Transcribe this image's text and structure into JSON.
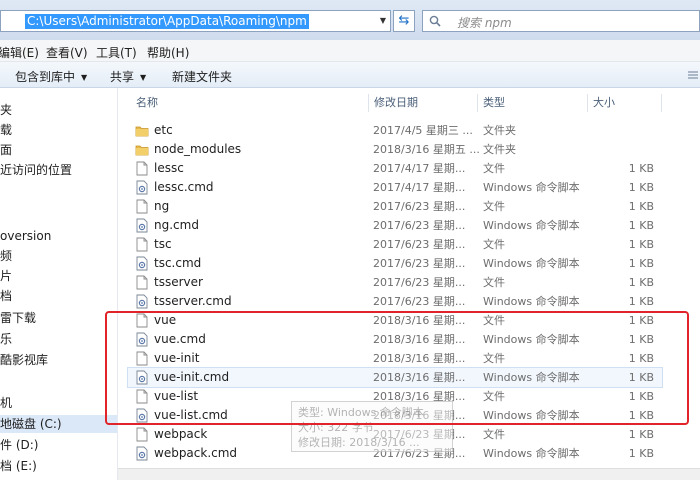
{
  "address": {
    "path": "C:\\Users\\Administrator\\AppData\\Roaming\\npm",
    "search_placeholder": "搜索 npm"
  },
  "menu": [
    "编辑(E)",
    "查看(V)",
    "工具(T)",
    "帮助(H)"
  ],
  "toolbar": {
    "include_library": "包含到库中",
    "share": "共享",
    "new_folder": "新建文件夹"
  },
  "nav": [
    {
      "label": "夹"
    },
    {
      "label": "载"
    },
    {
      "label": "面"
    },
    {
      "label": "近访问的位置"
    },
    {
      "label": ""
    },
    {
      "label": ""
    },
    {
      "label": "oversion"
    },
    {
      "label": "频"
    },
    {
      "label": "片"
    },
    {
      "label": "档"
    },
    {
      "label": "雷下载"
    },
    {
      "label": "乐"
    },
    {
      "label": "酷影视库"
    },
    {
      "label": ""
    },
    {
      "label": ""
    },
    {
      "label": "机"
    },
    {
      "label": "地磁盘 (C:)"
    },
    {
      "label": "件 (D:)"
    },
    {
      "label": "档 (E:)"
    }
  ],
  "columns": {
    "name": "名称",
    "date": "修改日期",
    "type": "类型",
    "size": "大小"
  },
  "files": [
    {
      "name": "etc",
      "date": "2017/4/5 星期三 ...",
      "type": "文件夹",
      "size": "",
      "icon": "folder-icon"
    },
    {
      "name": "node_modules",
      "date": "2018/3/16 星期五 ...",
      "type": "文件夹",
      "size": "",
      "icon": "folder-icon"
    },
    {
      "name": "lessc",
      "date": "2017/4/17 星期...",
      "type": "文件",
      "size": "1 KB",
      "icon": "file-icon"
    },
    {
      "name": "lessc.cmd",
      "date": "2017/4/17 星期...",
      "type": "Windows 命令脚本",
      "size": "1 KB",
      "icon": "cmd-icon"
    },
    {
      "name": "ng",
      "date": "2017/6/23 星期...",
      "type": "文件",
      "size": "1 KB",
      "icon": "file-icon"
    },
    {
      "name": "ng.cmd",
      "date": "2017/6/23 星期...",
      "type": "Windows 命令脚本",
      "size": "1 KB",
      "icon": "cmd-icon"
    },
    {
      "name": "tsc",
      "date": "2017/6/23 星期...",
      "type": "文件",
      "size": "1 KB",
      "icon": "file-icon"
    },
    {
      "name": "tsc.cmd",
      "date": "2017/6/23 星期...",
      "type": "Windows 命令脚本",
      "size": "1 KB",
      "icon": "cmd-icon"
    },
    {
      "name": "tsserver",
      "date": "2017/6/23 星期...",
      "type": "文件",
      "size": "1 KB",
      "icon": "file-icon"
    },
    {
      "name": "tsserver.cmd",
      "date": "2017/6/23 星期...",
      "type": "Windows 命令脚本",
      "size": "1 KB",
      "icon": "cmd-icon"
    },
    {
      "name": "vue",
      "date": "2018/3/16 星期...",
      "type": "文件",
      "size": "1 KB",
      "icon": "file-icon"
    },
    {
      "name": "vue.cmd",
      "date": "2018/3/16 星期...",
      "type": "Windows 命令脚本",
      "size": "1 KB",
      "icon": "cmd-icon"
    },
    {
      "name": "vue-init",
      "date": "2018/3/16 星期...",
      "type": "文件",
      "size": "1 KB",
      "icon": "file-icon"
    },
    {
      "name": "vue-init.cmd",
      "date": "2018/3/16 星期...",
      "type": "Windows 命令脚本",
      "size": "1 KB",
      "icon": "cmd-icon"
    },
    {
      "name": "vue-list",
      "date": "2018/3/16 星期...",
      "type": "文件",
      "size": "1 KB",
      "icon": "file-icon"
    },
    {
      "name": "vue-list.cmd",
      "date": "2018/3/16 星期...",
      "type": "Windows 命令脚本",
      "size": "1 KB",
      "icon": "cmd-icon"
    },
    {
      "name": "webpack",
      "date": "2017/6/23 星期...",
      "type": "文件",
      "size": "1 KB",
      "icon": "file-icon"
    },
    {
      "name": "webpack.cmd",
      "date": "2017/6/23 星期...",
      "type": "Windows 命令脚本",
      "size": "1 KB",
      "icon": "cmd-icon"
    }
  ],
  "tooltip": {
    "line1": "类型: Windows 命令脚本",
    "line2": "大小: 322 字节",
    "line3": "修改日期: 2018/3/16 ..."
  },
  "colors": {
    "selection": "#3399ff",
    "highlight_box": "#e0242a",
    "folder": "#e8b84a"
  }
}
